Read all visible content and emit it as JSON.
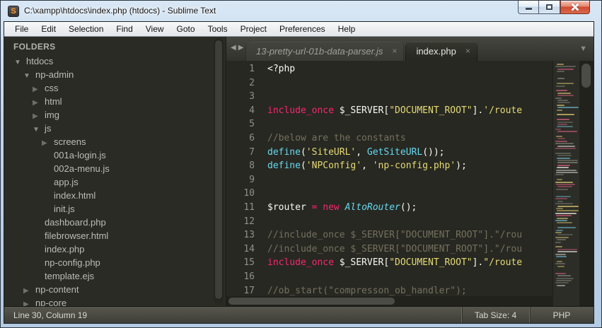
{
  "window": {
    "title": "C:\\xampp\\htdocs\\index.php (htdocs) - Sublime Text",
    "icon_letter": "S"
  },
  "menu": {
    "items": [
      "File",
      "Edit",
      "Selection",
      "Find",
      "View",
      "Goto",
      "Tools",
      "Project",
      "Preferences",
      "Help"
    ]
  },
  "icons": {
    "folder_open": "▼",
    "folder_closed": "▶",
    "tab_close": "×",
    "tab_nav_left": "◀",
    "tab_nav_right": "▶",
    "tab_dropdown": "▼"
  },
  "sidebar": {
    "header": "FOLDERS",
    "items": [
      {
        "label": "htdocs",
        "indent": 0,
        "type": "folder-open"
      },
      {
        "label": "np-admin",
        "indent": 1,
        "type": "folder-open"
      },
      {
        "label": "css",
        "indent": 2,
        "type": "folder-closed"
      },
      {
        "label": "html",
        "indent": 2,
        "type": "folder-closed"
      },
      {
        "label": "img",
        "indent": 2,
        "type": "folder-closed"
      },
      {
        "label": "js",
        "indent": 2,
        "type": "folder-open"
      },
      {
        "label": "screens",
        "indent": 3,
        "type": "folder-closed"
      },
      {
        "label": "001a-login.js",
        "indent": 3,
        "type": "file"
      },
      {
        "label": "002a-menu.js",
        "indent": 3,
        "type": "file"
      },
      {
        "label": "app.js",
        "indent": 3,
        "type": "file"
      },
      {
        "label": "index.html",
        "indent": 3,
        "type": "file"
      },
      {
        "label": "init.js",
        "indent": 3,
        "type": "file"
      },
      {
        "label": "dashboard.php",
        "indent": 2,
        "type": "file"
      },
      {
        "label": "filebrowser.html",
        "indent": 2,
        "type": "file"
      },
      {
        "label": "index.php",
        "indent": 2,
        "type": "file"
      },
      {
        "label": "np-config.php",
        "indent": 2,
        "type": "file"
      },
      {
        "label": "template.ejs",
        "indent": 2,
        "type": "file"
      }
    ],
    "items_after": [
      {
        "label": "np-content",
        "indent": 1,
        "type": "folder-closed"
      },
      {
        "label": "np-core",
        "indent": 1,
        "type": "folder-closed"
      }
    ]
  },
  "tabs": [
    {
      "label": "13-pretty-url-01b-data-parser.js",
      "active": false
    },
    {
      "label": "index.php",
      "active": true
    }
  ],
  "editor": {
    "lines": [
      {
        "n": "1",
        "tokens": [
          {
            "t": "<?php",
            "c": "w"
          }
        ]
      },
      {
        "n": "2",
        "tokens": []
      },
      {
        "n": "3",
        "tokens": []
      },
      {
        "n": "4",
        "tokens": [
          {
            "t": "include_once",
            "c": "k"
          },
          {
            "t": " $_SERVER[",
            "c": "w"
          },
          {
            "t": "\"DOCUMENT_ROOT\"",
            "c": "s"
          },
          {
            "t": "].",
            "c": "w"
          },
          {
            "t": "'/route",
            "c": "s"
          }
        ]
      },
      {
        "n": "5",
        "tokens": []
      },
      {
        "n": "6",
        "tokens": [
          {
            "t": "//below are the constants",
            "c": "cm"
          }
        ]
      },
      {
        "n": "7",
        "tokens": [
          {
            "t": "define",
            "c": "f"
          },
          {
            "t": "(",
            "c": "w"
          },
          {
            "t": "'SiteURL'",
            "c": "s"
          },
          {
            "t": ", ",
            "c": "w"
          },
          {
            "t": "GetSiteURL",
            "c": "f"
          },
          {
            "t": "());",
            "c": "w"
          }
        ]
      },
      {
        "n": "8",
        "tokens": [
          {
            "t": "define",
            "c": "f"
          },
          {
            "t": "(",
            "c": "w"
          },
          {
            "t": "'NPConfig'",
            "c": "s"
          },
          {
            "t": ", ",
            "c": "w"
          },
          {
            "t": "'np-config.php'",
            "c": "s"
          },
          {
            "t": ");",
            "c": "w"
          }
        ]
      },
      {
        "n": "9",
        "tokens": []
      },
      {
        "n": "10",
        "tokens": []
      },
      {
        "n": "11",
        "tokens": [
          {
            "t": "$router ",
            "c": "w"
          },
          {
            "t": "=",
            "c": "k"
          },
          {
            "t": " ",
            "c": "w"
          },
          {
            "t": "new",
            "c": "k"
          },
          {
            "t": " ",
            "c": "w"
          },
          {
            "t": "AltoRouter",
            "c": "fi"
          },
          {
            "t": "();",
            "c": "w"
          }
        ]
      },
      {
        "n": "12",
        "tokens": []
      },
      {
        "n": "13",
        "tokens": [
          {
            "t": "//include_once $_SERVER[\"DOCUMENT_ROOT\"].\"/rou",
            "c": "cm"
          }
        ]
      },
      {
        "n": "14",
        "tokens": [
          {
            "t": "//include_once $_SERVER[\"DOCUMENT_ROOT\"].\"/rou",
            "c": "cm"
          }
        ]
      },
      {
        "n": "15",
        "tokens": [
          {
            "t": "include_once",
            "c": "k"
          },
          {
            "t": " $_SERVER[",
            "c": "w"
          },
          {
            "t": "\"DOCUMENT_ROOT\"",
            "c": "s"
          },
          {
            "t": "].",
            "c": "w"
          },
          {
            "t": "\"/route",
            "c": "s"
          }
        ]
      },
      {
        "n": "16",
        "tokens": []
      },
      {
        "n": "17",
        "tokens": [
          {
            "t": "//ob_start(\"compresson_ob_handler\");",
            "c": "cm"
          }
        ]
      }
    ]
  },
  "status_bar": {
    "left": "Line 30, Column 19",
    "tab_size": "Tab Size: 4",
    "syntax": "PHP"
  },
  "colors": {
    "editor_bg": "#272822",
    "keyword": "#f92672",
    "string": "#e6db74",
    "function": "#66d9ef",
    "comment": "#75715e",
    "text": "#f8f8f2",
    "minimap_palette": [
      "#b0526b",
      "#b3a45e",
      "#6c6d62",
      "#c6c6c0",
      "#5f9aa8"
    ]
  }
}
